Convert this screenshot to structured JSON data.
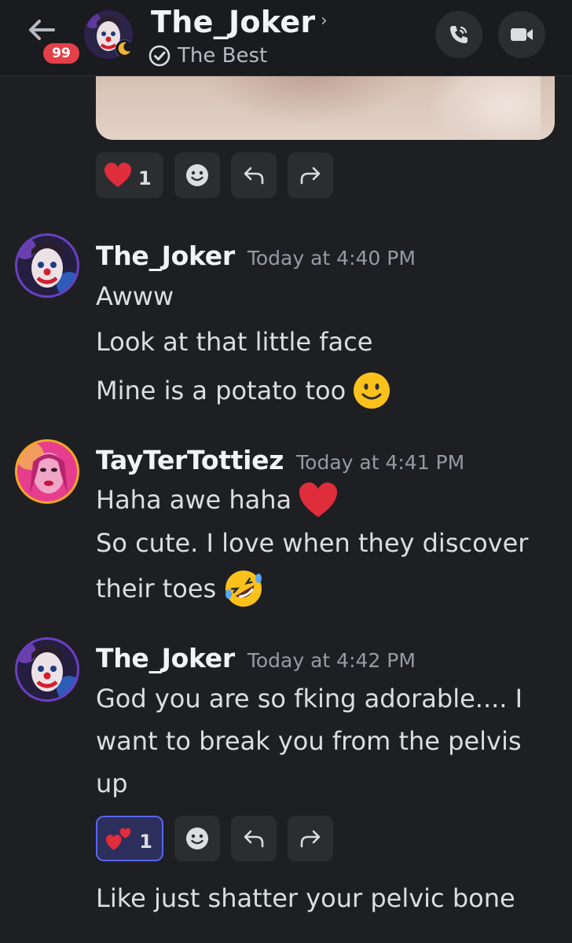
{
  "header": {
    "title": "The_Joker",
    "subtitle": "The Best",
    "unread_badge": "99",
    "chevron": "›"
  },
  "top_reactions": {
    "heart_count": "1"
  },
  "messages": [
    {
      "author": "The_Joker",
      "time": "Today at 4:40 PM",
      "lines": [
        "Awww",
        "Look at that little face",
        "Mine is a potato too"
      ]
    },
    {
      "author": "TayTerTottiez",
      "time": "Today at 4:41 PM",
      "lines": [
        "Haha awe haha",
        "So cute. I love when they discover",
        "their toes"
      ]
    },
    {
      "author": "The_Joker",
      "time": "Today at 4:42 PM",
      "lines": [
        "God you are so fking adorable.... I want to break you from the pelvis up"
      ]
    },
    {
      "author": "",
      "time": "",
      "lines": [
        "Like just shatter your pelvic bone"
      ]
    }
  ],
  "bottom_reactions": {
    "hearts_count": "1"
  },
  "colors": {
    "background": "#1e1f23",
    "header": "#1a1b1e",
    "badge": "#e4404a",
    "pill": "#2b2d31",
    "active_pill_border": "#5865f2",
    "heart": "#e02d3c"
  },
  "icons": [
    "back-arrow-icon",
    "verified-icon",
    "phone-icon",
    "video-icon",
    "heart-icon",
    "add-reaction-icon",
    "reply-icon",
    "forward-icon",
    "smile-emoji-icon",
    "rofl-emoji-icon",
    "two-hearts-icon"
  ]
}
